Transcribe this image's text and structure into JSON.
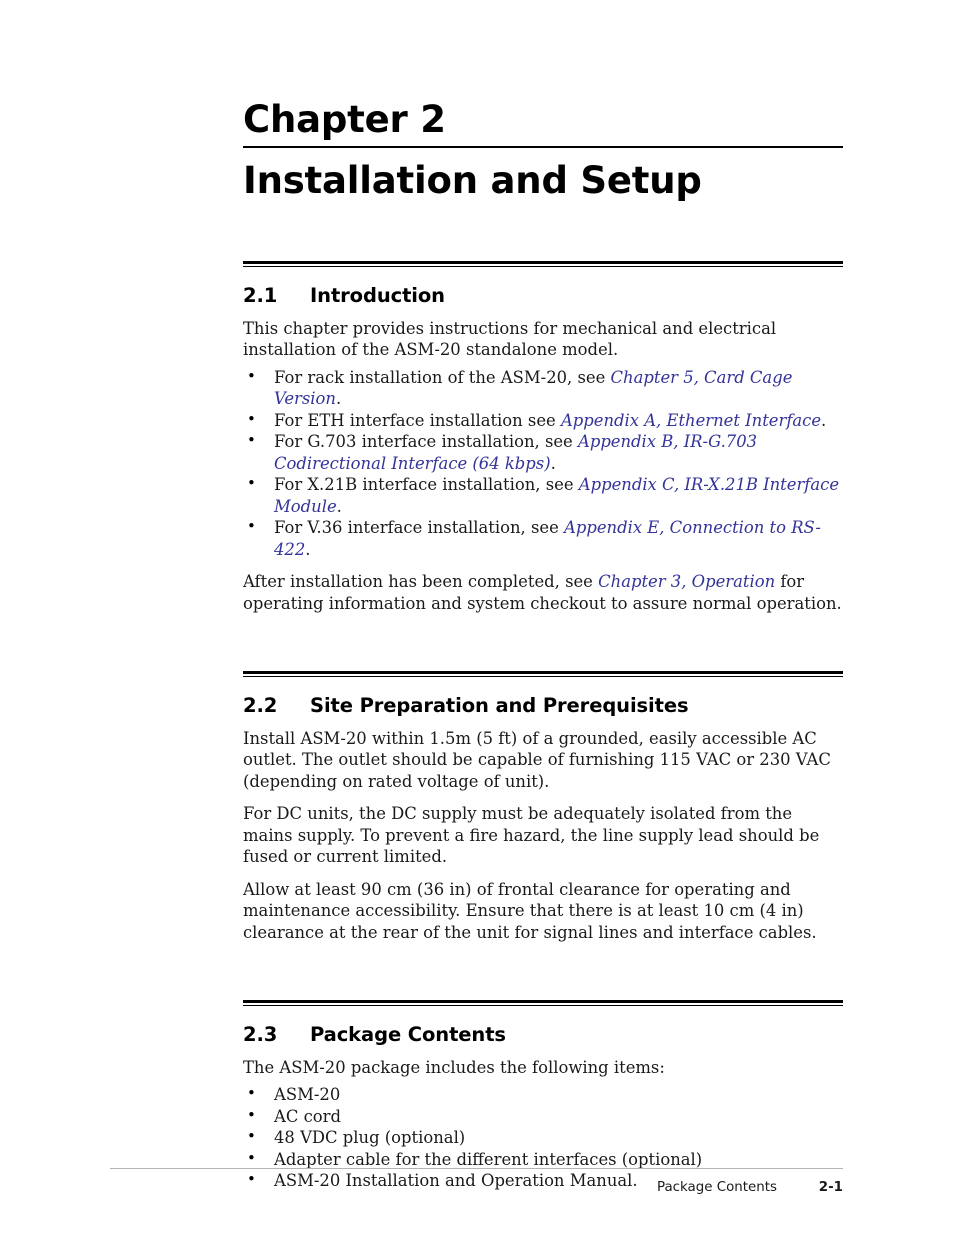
{
  "chapter": {
    "label": "Chapter 2",
    "title": "Installation and Setup"
  },
  "colors": {
    "text": "#1a1a1a",
    "heading": "#000000",
    "cross_reference": "#333399",
    "rule": "#000000",
    "footer_rule": "#b4b4b4"
  },
  "sections": [
    {
      "number": "2.1",
      "title": "Introduction",
      "intro": "This chapter provides instructions for mechanical and electrical installation of the ASM-20 standalone model.",
      "bullets": [
        {
          "lead": "For rack installation of the ASM-20, see ",
          "xref": "Chapter 5, Card Cage Version",
          "tail": "."
        },
        {
          "lead": "For ETH interface installation see ",
          "xref": "Appendix A, Ethernet Interface",
          "tail": "."
        },
        {
          "lead": "For G.703 interface installation, see ",
          "xref": "Appendix B, IR-G.703 Codirectional Interface (64 kbps)",
          "tail": "."
        },
        {
          "lead": "For X.21B interface installation, see ",
          "xref": "Appendix C, IR-X.21B Interface Module",
          "tail": "."
        },
        {
          "lead": "For V.36 interface installation, see ",
          "xref": "Appendix E, Connection to RS-422",
          "tail": "."
        }
      ],
      "closing": {
        "lead": "After installation has been completed, see ",
        "xref": "Chapter 3, Operation",
        "tail": " for operating information and system checkout to assure normal operation."
      }
    },
    {
      "number": "2.2",
      "title": "Site Preparation and Prerequisites",
      "paragraphs": [
        "Install ASM-20 within 1.5m (5 ft) of a grounded, easily accessible AC outlet. The outlet should be capable of furnishing 115 VAC or 230 VAC (depending on rated voltage of unit).",
        "For DC units, the DC supply must be adequately isolated from the mains supply. To prevent a fire hazard, the line supply lead should be fused or current limited.",
        "Allow at least 90 cm (36 in) of frontal clearance for operating and maintenance accessibility. Ensure that there is at least 10 cm (4 in) clearance at the rear of the unit for signal lines and interface cables."
      ]
    },
    {
      "number": "2.3",
      "title": "Package Contents",
      "intro": "The ASM-20 package includes the following items:",
      "bullets": [
        {
          "lead": "ASM-20",
          "xref": "",
          "tail": ""
        },
        {
          "lead": "AC cord",
          "xref": "",
          "tail": ""
        },
        {
          "lead": "48 VDC plug (optional)",
          "xref": "",
          "tail": ""
        },
        {
          "lead": "Adapter cable for the different interfaces (optional)",
          "xref": "",
          "tail": ""
        },
        {
          "lead": "ASM-20 Installation and Operation Manual.",
          "xref": "",
          "tail": ""
        }
      ]
    }
  ],
  "footer": {
    "title": "Package Contents",
    "page": "2-1"
  }
}
